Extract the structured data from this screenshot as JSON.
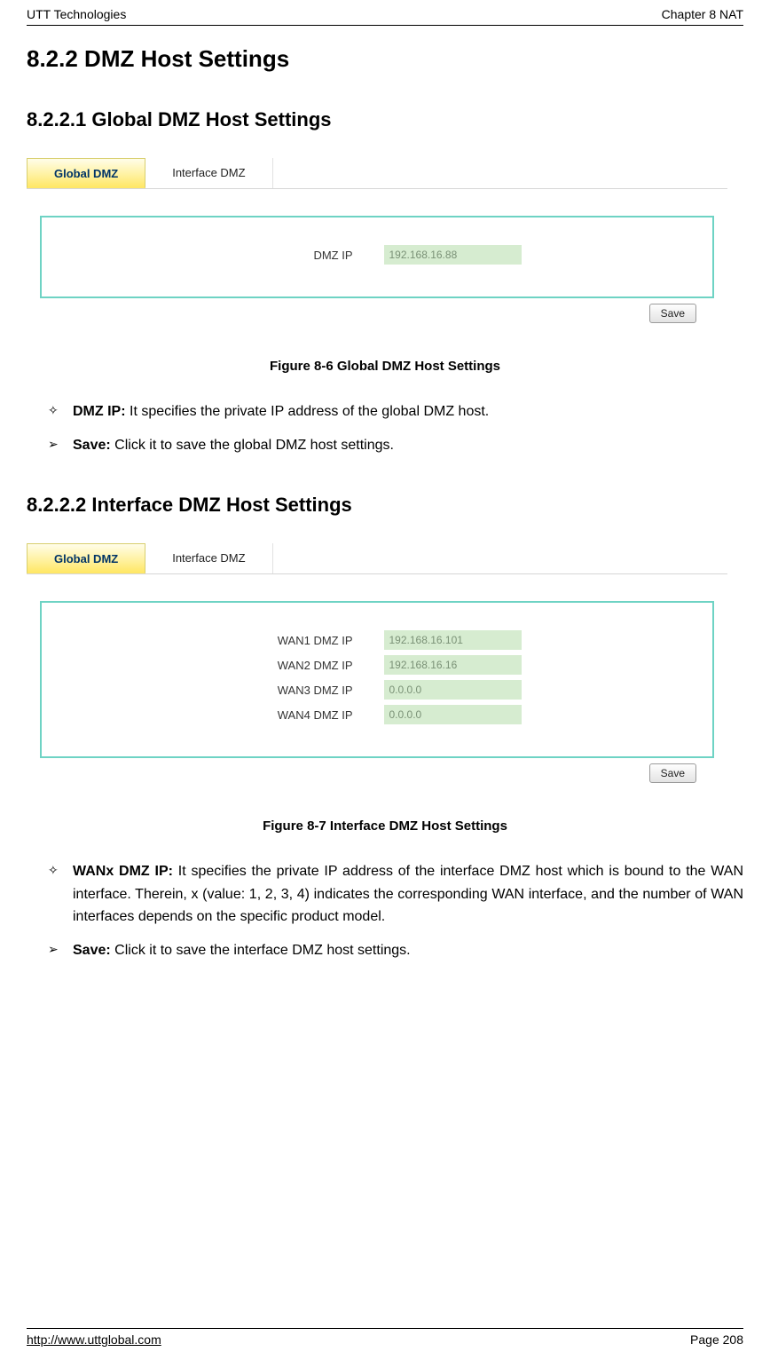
{
  "header": {
    "left": "UTT Technologies",
    "right": "Chapter 8 NAT"
  },
  "section": {
    "num_title": "8.2.2    DMZ Host Settings",
    "sub1_title": "8.2.2.1   Global DMZ Host Settings",
    "sub2_title": "8.2.2.2   Interface DMZ Host Settings"
  },
  "fig1": {
    "tabs": {
      "global": "Global DMZ",
      "interface": "Interface DMZ"
    },
    "field_label": "DMZ IP",
    "field_value": "192.168.16.88",
    "save": "Save",
    "caption": "Figure 8-6 Global DMZ Host Settings"
  },
  "bullets1": {
    "dmz_label": "DMZ IP:",
    "dmz_text": " It specifies the private IP address of the global DMZ host.",
    "save_label": "Save:",
    "save_text": " Click it to save the global DMZ host settings."
  },
  "fig2": {
    "tabs": {
      "global": "Global DMZ",
      "interface": "Interface DMZ"
    },
    "rows": [
      {
        "label": "WAN1 DMZ IP",
        "value": "192.168.16.101"
      },
      {
        "label": "WAN2 DMZ IP",
        "value": "192.168.16.16"
      },
      {
        "label": "WAN3 DMZ IP",
        "value": "0.0.0.0"
      },
      {
        "label": "WAN4 DMZ IP",
        "value": "0.0.0.0"
      }
    ],
    "save": "Save",
    "caption": "Figure 8-7 Interface DMZ Host Settings"
  },
  "bullets2": {
    "wan_label": "WANx DMZ IP:",
    "wan_text": " It specifies the private IP address of the interface DMZ host which is bound to the WAN interface. Therein, x (value: 1, 2, 3, 4) indicates the corresponding WAN interface, and the number of WAN interfaces depends on the specific product model.",
    "save_label": "Save:",
    "save_text": " Click it to save the interface DMZ host settings."
  },
  "footer": {
    "url": "http://www.uttglobal.com",
    "page": "Page  208"
  },
  "glyphs": {
    "diamond": "✧",
    "chevron": "➢"
  }
}
